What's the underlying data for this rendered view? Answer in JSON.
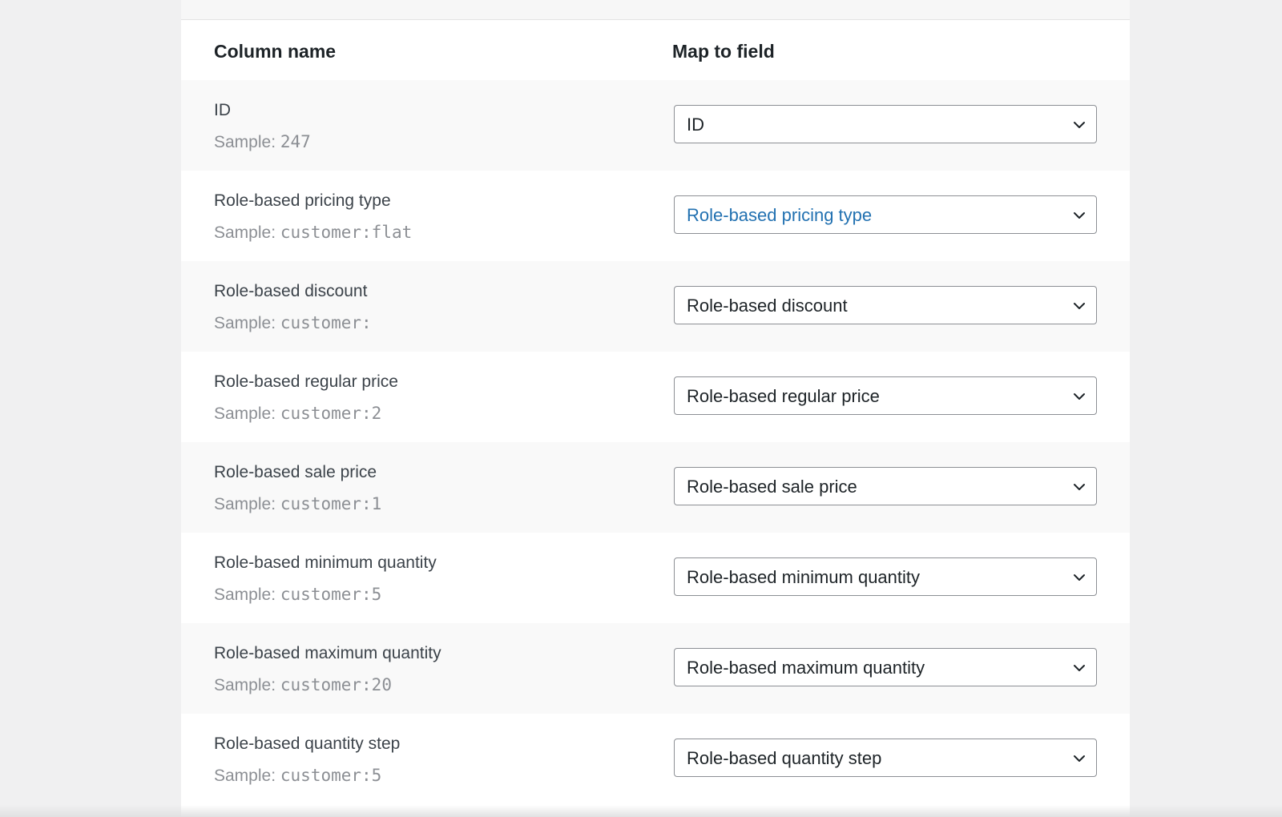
{
  "table": {
    "header": {
      "column_name": "Column name",
      "map_to_field": "Map to field"
    },
    "rows": [
      {
        "name": "ID",
        "sample_prefix": "Sample:",
        "sample_value": "247",
        "mapped": "ID",
        "highlight": false
      },
      {
        "name": "Role-based pricing type",
        "sample_prefix": "Sample:",
        "sample_value": "customer:flat",
        "mapped": "Role-based pricing type",
        "highlight": true
      },
      {
        "name": "Role-based discount",
        "sample_prefix": "Sample:",
        "sample_value": "customer:",
        "mapped": "Role-based discount",
        "highlight": false
      },
      {
        "name": "Role-based regular price",
        "sample_prefix": "Sample:",
        "sample_value": "customer:2",
        "mapped": "Role-based regular price",
        "highlight": false
      },
      {
        "name": "Role-based sale price",
        "sample_prefix": "Sample:",
        "sample_value": "customer:1",
        "mapped": "Role-based sale price",
        "highlight": false
      },
      {
        "name": "Role-based minimum quantity",
        "sample_prefix": "Sample:",
        "sample_value": "customer:5",
        "mapped": "Role-based minimum quantity",
        "highlight": false
      },
      {
        "name": "Role-based maximum quantity",
        "sample_prefix": "Sample:",
        "sample_value": "customer:20",
        "mapped": "Role-based maximum quantity",
        "highlight": false
      },
      {
        "name": "Role-based quantity step",
        "sample_prefix": "Sample:",
        "sample_value": "customer:5",
        "mapped": "Role-based quantity step",
        "highlight": false
      }
    ]
  },
  "icons": {
    "select_arrow": "chevron-down-icon"
  },
  "colors": {
    "highlight_text": "#2271b1",
    "text": "#1d2327",
    "muted": "#8c8f94",
    "page_bg": "#f0f0f1",
    "row_alt_bg": "#f9f9f9"
  }
}
